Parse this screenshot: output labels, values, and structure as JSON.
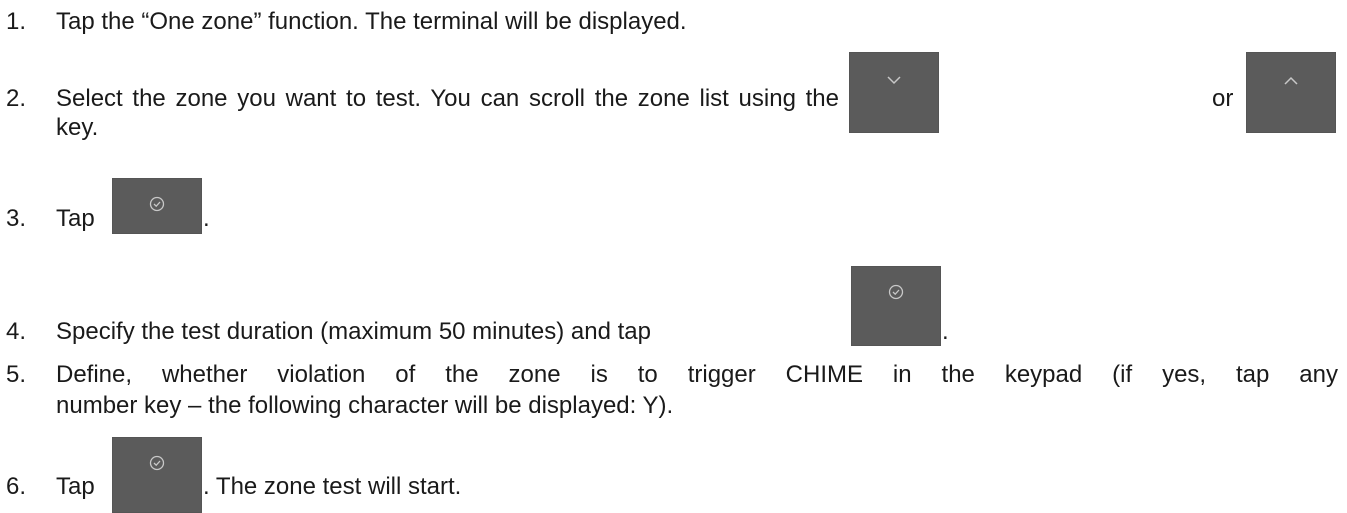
{
  "steps": [
    {
      "number": "1.",
      "text": "Tap the “One zone” function. The terminal will be displayed."
    },
    {
      "number": "2.",
      "text_before": "Select the zone you want to test. You can scroll the zone list using the",
      "text_between": "or",
      "text_continued": "key."
    },
    {
      "number": "3.",
      "text_before": "Tap",
      "text_after": "."
    },
    {
      "number": "4.",
      "text_before": "Specify the test duration (maximum 50 minutes) and tap",
      "text_after": "."
    },
    {
      "number": "5.",
      "text_line1": "Define, whether violation of the zone is to trigger CHIME in the keypad (if yes, tap any",
      "text_line2": "number key – the following character will be displayed: Y)."
    },
    {
      "number": "6.",
      "text_before": "Tap",
      "text_after": ". The zone test will start."
    }
  ],
  "icons": {
    "down": "chevron-down-icon",
    "up": "chevron-up-icon",
    "confirm": "check-circle-icon"
  },
  "colors": {
    "key_background": "#5b5b5b",
    "key_glyph": "#c8c8c8",
    "text": "#1a1a1a"
  }
}
